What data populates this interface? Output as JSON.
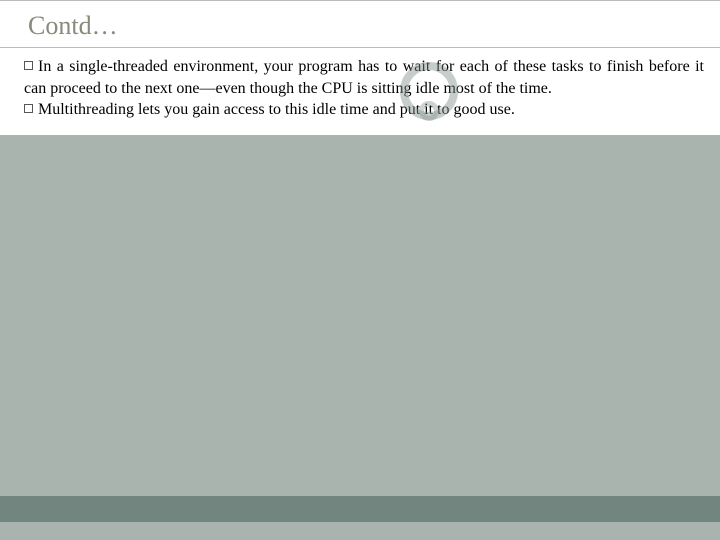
{
  "title": "Contd…",
  "bullets": [
    "In a single-threaded environment, your program has to wait for each of these tasks to finish before it can proceed to the next one—even though the CPU is sitting idle most of the time.",
    "Multithreading lets you gain access to this idle time and put it to good use."
  ]
}
